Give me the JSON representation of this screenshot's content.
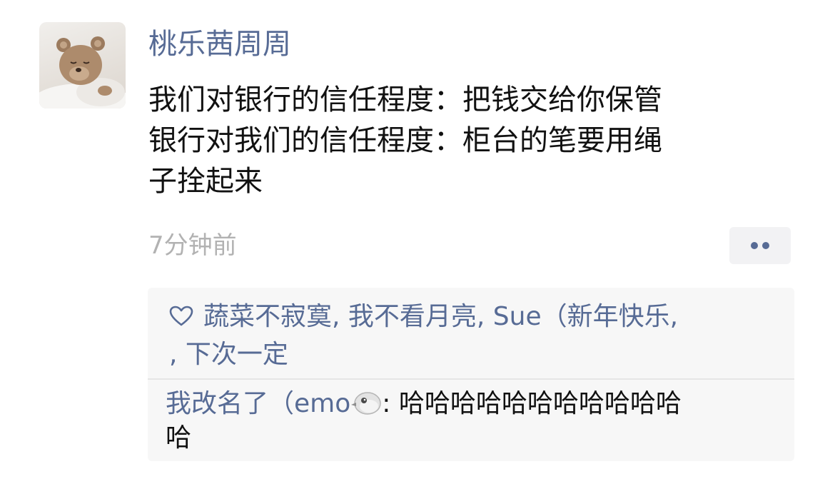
{
  "post": {
    "username": "桃乐茜周周",
    "content_lines": [
      "我们对银行的信任程度：把钱交给你保管",
      "银行对我们的信任程度：柜台的笔要用绳",
      "子拴起来"
    ],
    "time": "7分钟前"
  },
  "likes": {
    "line1": "蔬菜不寂寞, 我不看月亮, Sue（新年快乐,",
    "line2": ", 下次一定",
    "icon": "heart-outline-icon"
  },
  "comment": {
    "author": "我改名了（emo",
    "author_emoji": "bird-face-icon",
    "separator": ": ",
    "text_line1": "哈哈哈哈哈哈哈哈哈哈哈",
    "text_line2": "哈"
  },
  "colors": {
    "link": "#576b95",
    "text": "#111111",
    "timestamp": "#b2b2b2",
    "panel": "#f7f7f7"
  }
}
